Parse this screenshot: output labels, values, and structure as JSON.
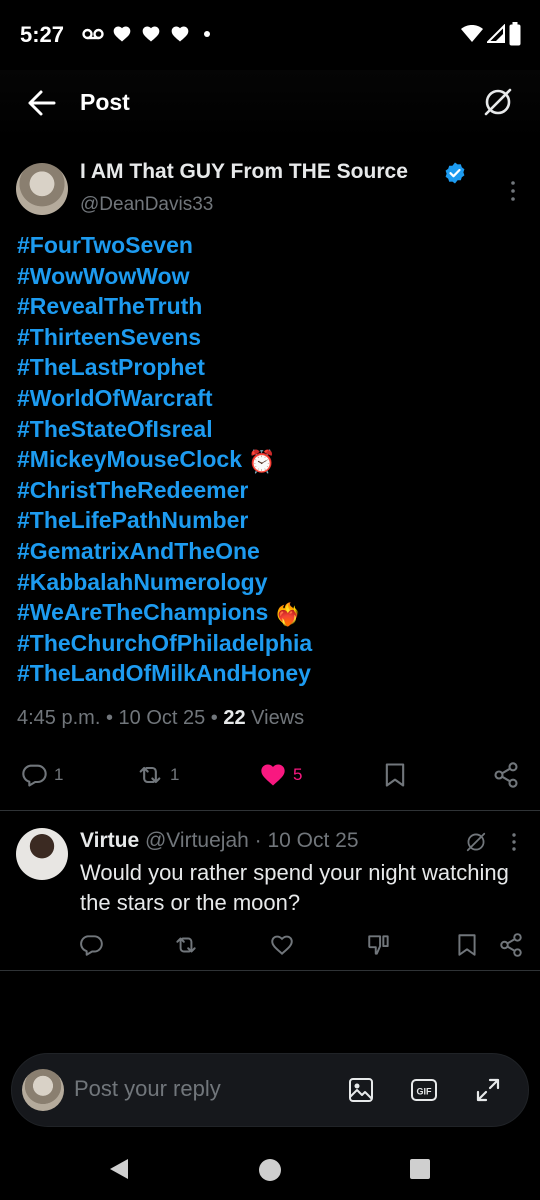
{
  "status_bar": {
    "time": "5:27"
  },
  "header": {
    "title": "Post"
  },
  "post": {
    "author_name": "I AM That GUY From THE Source",
    "author_handle": "@DeanDavis33",
    "hashtags": [
      {
        "text": "#FourTwoSeven",
        "emoji": ""
      },
      {
        "text": "#WowWowWow",
        "emoji": ""
      },
      {
        "text": "#RevealTheTruth",
        "emoji": ""
      },
      {
        "text": "#ThirteenSevens",
        "emoji": ""
      },
      {
        "text": "#TheLastProphet",
        "emoji": ""
      },
      {
        "text": "#WorldOfWarcraft",
        "emoji": ""
      },
      {
        "text": "#TheStateOfIsreal",
        "emoji": ""
      },
      {
        "text": "#MickeyMouseClock",
        "emoji": "⏰"
      },
      {
        "text": "#ChristTheRedeemer",
        "emoji": ""
      },
      {
        "text": "#TheLifePathNumber",
        "emoji": ""
      },
      {
        "text": "#GematrixAndTheOne",
        "emoji": ""
      },
      {
        "text": "#KabbalahNumerology",
        "emoji": ""
      },
      {
        "text": "#WeAreTheChampions",
        "emoji": "❤️‍🔥"
      },
      {
        "text": "#TheChurchOfPhiladelphia",
        "emoji": ""
      },
      {
        "text": "#TheLandOfMilkAndHoney",
        "emoji": ""
      }
    ],
    "time": "4:45 p.m.",
    "date": "10 Oct 25",
    "views_count": "22",
    "views_label": "Views",
    "reply_count": "1",
    "repost_count": "1",
    "like_count": "5"
  },
  "reply": {
    "name": "Virtue",
    "handle": "@Virtuejah",
    "date": "10 Oct 25",
    "text": "Would you rather spend your night watching the stars or the moon?"
  },
  "composer": {
    "placeholder": "Post your reply"
  },
  "colors": {
    "accent": "#1d9bf0",
    "like": "#f91880",
    "muted": "#71767b"
  }
}
